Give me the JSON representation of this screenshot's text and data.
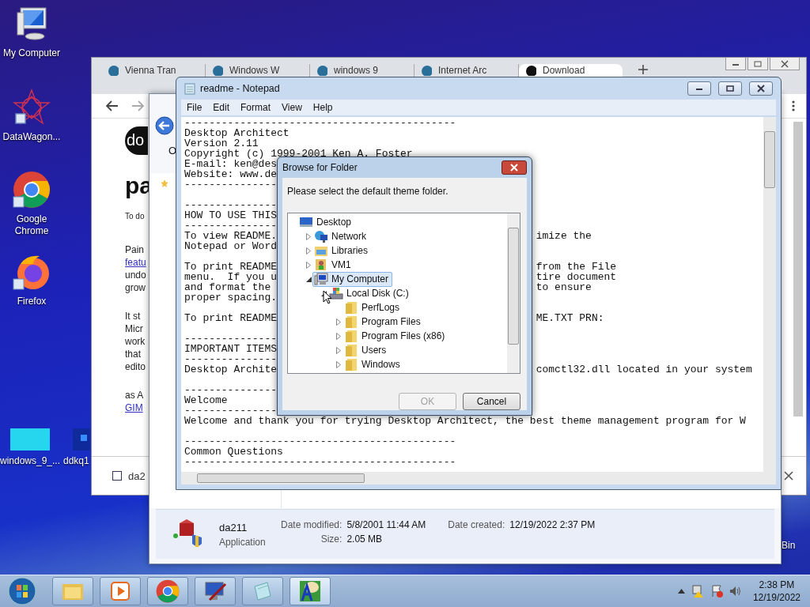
{
  "desktop": {
    "icons": [
      {
        "label": "My Computer",
        "kind": "computer"
      },
      {
        "label": "DataWagon...",
        "kind": "mandala"
      },
      {
        "label": "Google Chrome",
        "kind": "chrome"
      },
      {
        "label": "Firefox",
        "kind": "firefox"
      }
    ],
    "bottom_icons": [
      {
        "label": "windows_9_...",
        "kind": "screen"
      },
      {
        "label": "ddkq1",
        "kind": "win"
      }
    ],
    "edge_label": "Bin"
  },
  "browser": {
    "tabs": [
      {
        "title": "Vienna Tran",
        "selected": false
      },
      {
        "title": "Windows W",
        "selected": false
      },
      {
        "title": "windows 9",
        "selected": false
      },
      {
        "title": "Internet Arc",
        "selected": false
      },
      {
        "title": "Download",
        "selected": true
      }
    ],
    "logo": "do",
    "heading": "pa",
    "content": [
      {
        "text": "To do",
        "kind": "small"
      },
      {
        "text": "Pain",
        "kind": "text"
      },
      {
        "text": "featu",
        "kind": "link"
      },
      {
        "text": "undo",
        "kind": "text"
      },
      {
        "text": "grow",
        "kind": "text"
      },
      {
        "text": "It st",
        "kind": "gap"
      },
      {
        "text": "Micr",
        "kind": "text"
      },
      {
        "text": "work",
        "kind": "text"
      },
      {
        "text": "that",
        "kind": "text"
      },
      {
        "text": "edito",
        "kind": "text"
      },
      {
        "text": "as A",
        "kind": "gap"
      },
      {
        "text": "GIM",
        "kind": "link"
      }
    ],
    "download": "da2"
  },
  "explorer": {
    "toolbar_label": "O",
    "details": {
      "name": "da211",
      "type": "Application",
      "modified_label": "Date modified:",
      "modified": "5/8/2001 11:44 AM",
      "created_label": "Date created:",
      "created": "12/19/2022 2:37 PM",
      "size_label": "Size:",
      "size": "2.05 MB"
    }
  },
  "notepad": {
    "title": "readme - Notepad",
    "menu": [
      "File",
      "Edit",
      "Format",
      "View",
      "Help"
    ],
    "paragraphs": [
      {
        "lines": [
          {
            "text": "--------------------------------------------"
          },
          {
            "text": "Desktop Architect"
          },
          {
            "text": "Version 2.11"
          },
          {
            "text": "Copyright (c) 1999-2001 Ken A. Foster"
          },
          {
            "text": "E-mail: ken@des"
          },
          {
            "text": "Website: www.de"
          },
          {
            "text": "---------------"
          }
        ]
      },
      {
        "lines": [
          {
            "text": "---------------"
          },
          {
            "text": "HOW TO USE THIS"
          },
          {
            "text": "---------------"
          },
          {
            "text": "To view README.",
            "right": "imize the"
          },
          {
            "text": "Notepad or Word"
          }
        ]
      },
      {
        "lines": [
          {
            "text": "To print README",
            "right": "from the File"
          },
          {
            "text": "menu.  If you u",
            "right": "tire document"
          },
          {
            "text": "and format the",
            "right": "to ensure"
          },
          {
            "text": "proper spacing."
          }
        ]
      },
      {
        "lines": [
          {
            "text": "To print README",
            "right": "ME.TXT PRN:"
          }
        ]
      },
      {
        "lines": [
          {
            "text": "---------------"
          },
          {
            "text": "IMPORTANT ITEMS"
          },
          {
            "text": "---------------"
          },
          {
            "text": "Desktop Archite",
            "right": "comctl32.dll located in your system"
          }
        ]
      },
      {
        "lines": [
          {
            "text": "---------------"
          },
          {
            "text": "Welcome"
          },
          {
            "text": "---------------"
          },
          {
            "text": "Welcome and thank you for trying Desktop Architect, the best theme management program for W"
          }
        ]
      },
      {
        "lines": [
          {
            "text": "--------------------------------------------"
          },
          {
            "text": "Common Questions"
          },
          {
            "text": "--------------------------------------------"
          }
        ]
      }
    ]
  },
  "dialog": {
    "title": "Browse for Folder",
    "prompt": "Please select the default theme folder.",
    "tree": [
      {
        "label": "Desktop",
        "kind": "desktop",
        "selected": false,
        "children": [
          {
            "label": "Network",
            "kind": "network",
            "expanded": false,
            "selected": false
          },
          {
            "label": "Libraries",
            "kind": "libraries",
            "expanded": false,
            "selected": false
          },
          {
            "label": "VM1",
            "kind": "user",
            "expanded": false,
            "selected": false
          },
          {
            "label": "My Computer",
            "kind": "computer",
            "expanded": true,
            "selected": true,
            "children": [
              {
                "label": "Local Disk (C:)",
                "kind": "drive",
                "expanded": true,
                "selected": false,
                "children": [
                  {
                    "label": "PerfLogs",
                    "kind": "folder",
                    "selected": false
                  },
                  {
                    "label": "Program Files",
                    "kind": "folder",
                    "expanded": false,
                    "selected": false
                  },
                  {
                    "label": "Program Files (x86)",
                    "kind": "folder",
                    "expanded": false,
                    "selected": false
                  },
                  {
                    "label": "Users",
                    "kind": "folder",
                    "expanded": false,
                    "selected": false
                  },
                  {
                    "label": "Windows",
                    "kind": "folder",
                    "expanded": false,
                    "selected": false
                  }
                ]
              }
            ]
          }
        ]
      }
    ],
    "buttons": [
      {
        "label": "OK",
        "disabled": true
      },
      {
        "label": "Cancel",
        "disabled": false
      }
    ]
  },
  "clock": {
    "time": "2:38 PM",
    "date": "12/19/2022"
  }
}
